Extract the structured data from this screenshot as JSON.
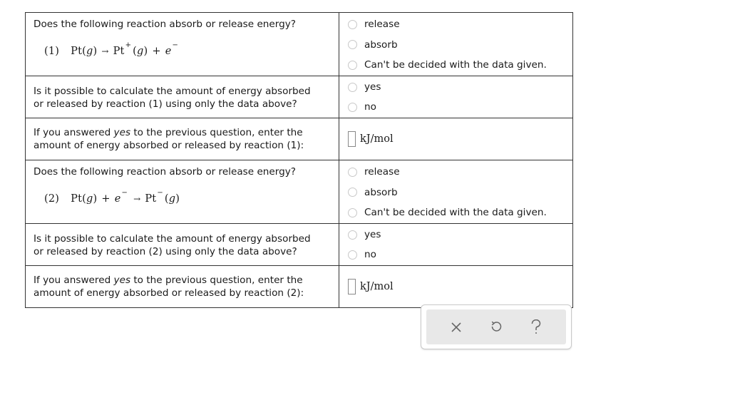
{
  "questions": [
    {
      "type": "reaction",
      "prompt": "Does the following reaction absorb or release energy?",
      "equation": {
        "number": "(1)",
        "parts": [
          {
            "text": "Pt",
            "style": "normal"
          },
          {
            "text": "(",
            "style": "normal"
          },
          {
            "text": "g",
            "style": "italic"
          },
          {
            "text": ")",
            "style": "normal"
          },
          {
            "text": "→",
            "style": "arrow"
          },
          {
            "text": "Pt",
            "style": "normal"
          },
          {
            "text": "+",
            "style": "sup"
          },
          {
            "text": "(",
            "style": "normal"
          },
          {
            "text": "g",
            "style": "italic"
          },
          {
            "text": ")",
            "style": "normal"
          },
          {
            "text": "+",
            "style": "plus"
          },
          {
            "text": "e",
            "style": "italic"
          },
          {
            "text": "−",
            "style": "sup"
          }
        ]
      },
      "options": [
        "release",
        "absorb",
        "Can't be decided with the data given."
      ]
    },
    {
      "type": "possible",
      "prompt_line1": "Is it possible to calculate the amount of energy absorbed",
      "prompt_line2": "or released by reaction (1) using only the data above?",
      "options": [
        "yes",
        "no"
      ]
    },
    {
      "type": "enter",
      "prompt_pre": "If you answered ",
      "prompt_em": "yes",
      "prompt_post": " to the previous question, enter the",
      "prompt_line2": "amount of energy absorbed or released by reaction (1):",
      "input_value": "",
      "unit": "kJ/mol"
    },
    {
      "type": "reaction",
      "prompt": "Does the following reaction absorb or release energy?",
      "equation": {
        "number": "(2)",
        "parts": [
          {
            "text": "Pt",
            "style": "normal"
          },
          {
            "text": "(",
            "style": "normal"
          },
          {
            "text": "g",
            "style": "italic"
          },
          {
            "text": ")",
            "style": "normal"
          },
          {
            "text": "+",
            "style": "plus"
          },
          {
            "text": "e",
            "style": "italic"
          },
          {
            "text": "−",
            "style": "sup"
          },
          {
            "text": "→",
            "style": "arrow"
          },
          {
            "text": "Pt",
            "style": "normal"
          },
          {
            "text": "−",
            "style": "sup"
          },
          {
            "text": "(",
            "style": "normal"
          },
          {
            "text": "g",
            "style": "italic"
          },
          {
            "text": ")",
            "style": "normal"
          }
        ]
      },
      "options": [
        "release",
        "absorb",
        "Can't be decided with the data given."
      ]
    },
    {
      "type": "possible",
      "prompt_line1": "Is it possible to calculate the amount of energy absorbed",
      "prompt_line2": "or released by reaction (2) using only the data above?",
      "options": [
        "yes",
        "no"
      ]
    },
    {
      "type": "enter",
      "prompt_pre": "If you answered ",
      "prompt_em": "yes",
      "prompt_post": " to the previous question, enter the",
      "prompt_line2": "amount of energy absorbed or released by reaction (2):",
      "input_value": "",
      "unit": "kJ/mol"
    }
  ],
  "toolbar": {
    "buttons": [
      {
        "name": "clear",
        "icon": "close-icon",
        "glyph": "×"
      },
      {
        "name": "undo",
        "icon": "undo-icon",
        "glyph": "↺"
      },
      {
        "name": "help",
        "icon": "help-icon",
        "glyph": "?"
      }
    ]
  }
}
